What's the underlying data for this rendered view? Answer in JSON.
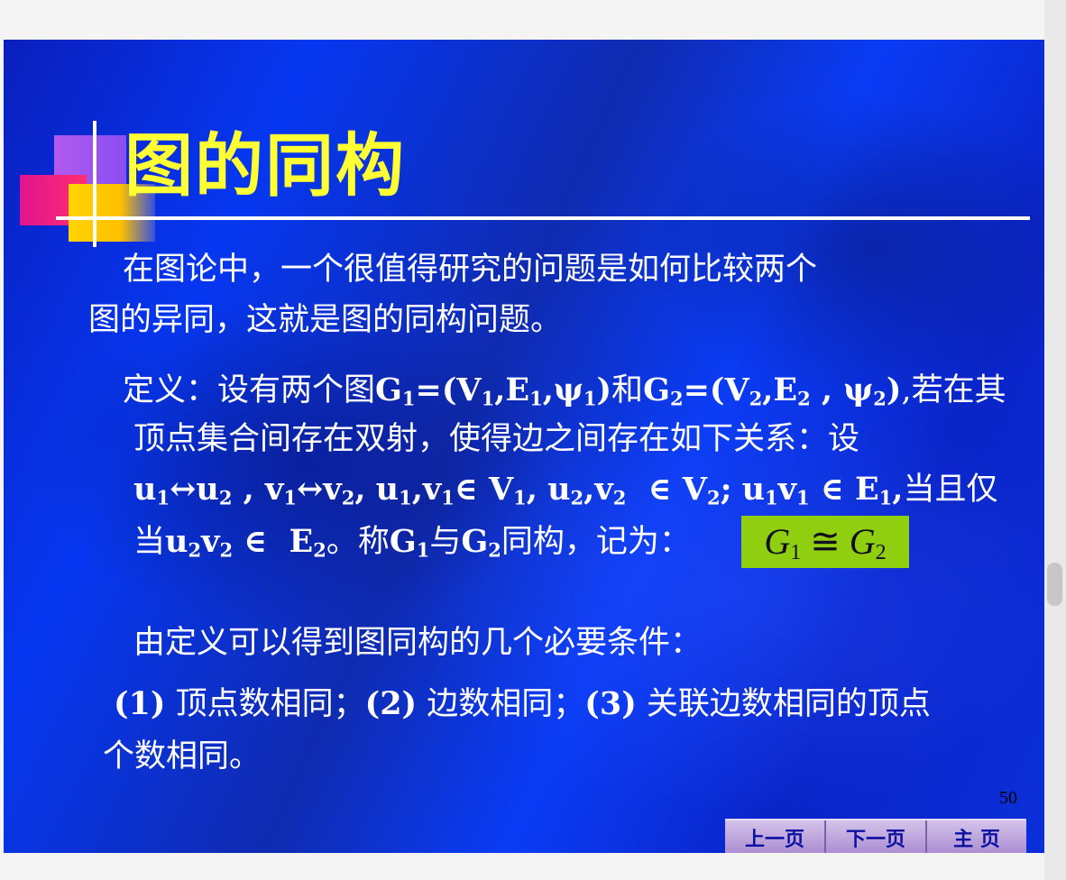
{
  "slide": {
    "title": "图的同构",
    "intro_line1": "在图论中，一个很值得研究的问题是如何比较两个",
    "intro_line2": "图的异同，这就是图的同构问题。",
    "def_label": "定义：",
    "def_text_a": "设有两个图",
    "def_and": "和",
    "def_if": ",若在其",
    "def_line2": "顶点集合间存在双射，使得边之间存在如下关系：设",
    "def_sep": "，",
    "def_iff": "当且仅",
    "def_when": "当",
    "def_called": "。称",
    "def_with": "与",
    "def_iso": "同构，记为：",
    "formula": "G₁ ≅ G₂",
    "necessary_intro": "由定义可以得到图同构的几个必要条件：",
    "cond1_num": "(1)",
    "cond1": "顶点数相同；",
    "cond2_num": "(2)",
    "cond2": "边数相同；",
    "cond3_num": "(3)",
    "cond3": "关联边数相同的顶点",
    "cond_line2": "个数相同。",
    "page_number": "50"
  },
  "nav": {
    "prev": "上一页",
    "next": "下一页",
    "home": "主 页"
  },
  "colors": {
    "title": "#ffff33",
    "background": "#0a2fd9",
    "formula_box": "#8fcf10",
    "nav_button": "#c0a8e0"
  }
}
